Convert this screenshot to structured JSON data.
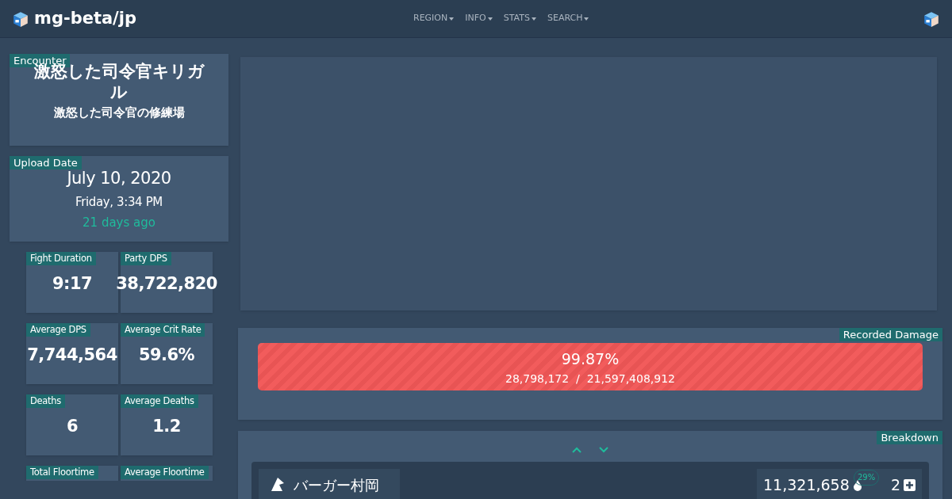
{
  "navbar": {
    "brand": "mg-beta/jp",
    "menus": [
      "REGION",
      "INFO",
      "STATS",
      "SEARCH"
    ]
  },
  "encounter": {
    "tag": "Encounter",
    "name": "激怒した司令官キリガル",
    "stage": "激怒した司令官の修練場"
  },
  "upload": {
    "tag": "Upload Date",
    "date": "July 10, 2020",
    "time": "Friday, 3:34 PM",
    "ago": "21 days ago"
  },
  "stats": [
    {
      "label": "Fight Duration",
      "value": "9:17"
    },
    {
      "label": "Party DPS",
      "value": "38,722,820"
    },
    {
      "label": "Average DPS",
      "value": "7,744,564"
    },
    {
      "label": "Average Crit Rate",
      "value": "59.6%"
    },
    {
      "label": "Deaths",
      "value": "6"
    },
    {
      "label": "Average Deaths",
      "value": "1.2"
    },
    {
      "label": "Total Floortime"
    },
    {
      "label": "Average Floortime"
    }
  ],
  "recorded_damage": {
    "tag": "Recorded Damage",
    "percent": "99.87%",
    "amounts": "28,798,172  /  21,597,408,912"
  },
  "breakdown": {
    "tag": "Breakdown",
    "players": [
      {
        "name": "バーガー村岡",
        "damage": "11,321,658",
        "share": "29%",
        "deaths": "2"
      }
    ]
  }
}
